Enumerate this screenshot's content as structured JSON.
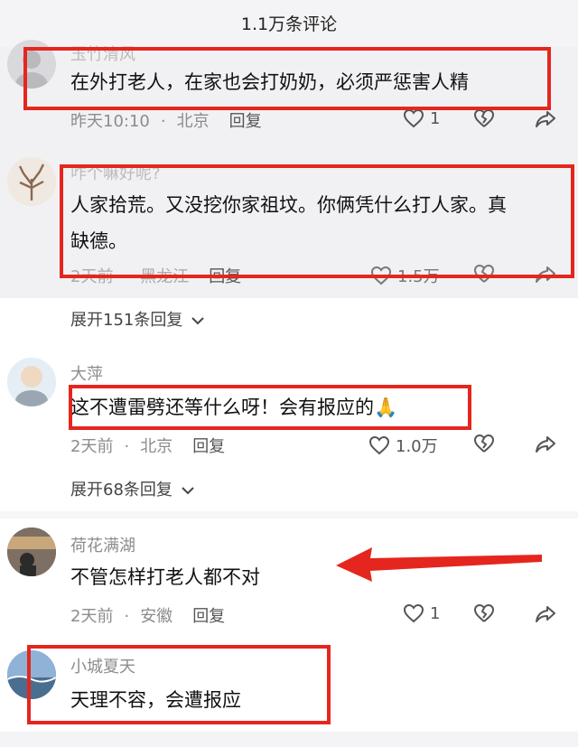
{
  "header": {
    "title": "1.1万条评论"
  },
  "comments": [
    {
      "username": "玉竹清风",
      "text_lines": [
        "在外打老人，在家也会打奶奶，必须严惩害人精"
      ],
      "time": "昨天10:10",
      "location": "北京",
      "reply_label": "回复",
      "likes": "1"
    },
    {
      "username": "咋个嘛好呢?",
      "text_lines": [
        "人家拾荒。又没挖你家祖坟。你俩凭什么打人家。真",
        "缺德。"
      ],
      "time": "2天前",
      "location": "黑龙江",
      "reply_label": "回复",
      "likes": "1.5万",
      "expand_label": "展开151条回复"
    },
    {
      "username": "大萍",
      "text_lines": [
        "这不遭雷劈还等什么呀！会有报应的🙏"
      ],
      "time": "2天前",
      "location": "北京",
      "reply_label": "回复",
      "likes": "1.0万",
      "expand_label": "展开68条回复"
    },
    {
      "username": "荷花满湖",
      "text_lines": [
        "不管怎样打老人都不对"
      ],
      "time": "2天前",
      "location": "安徽",
      "reply_label": "回复",
      "likes": "1"
    },
    {
      "username": "小城夏天",
      "text_lines": [
        "天理不容，会遭报应"
      ]
    }
  ],
  "colors": {
    "highlight": "#e5261e",
    "arrow": "#e5261e"
  }
}
